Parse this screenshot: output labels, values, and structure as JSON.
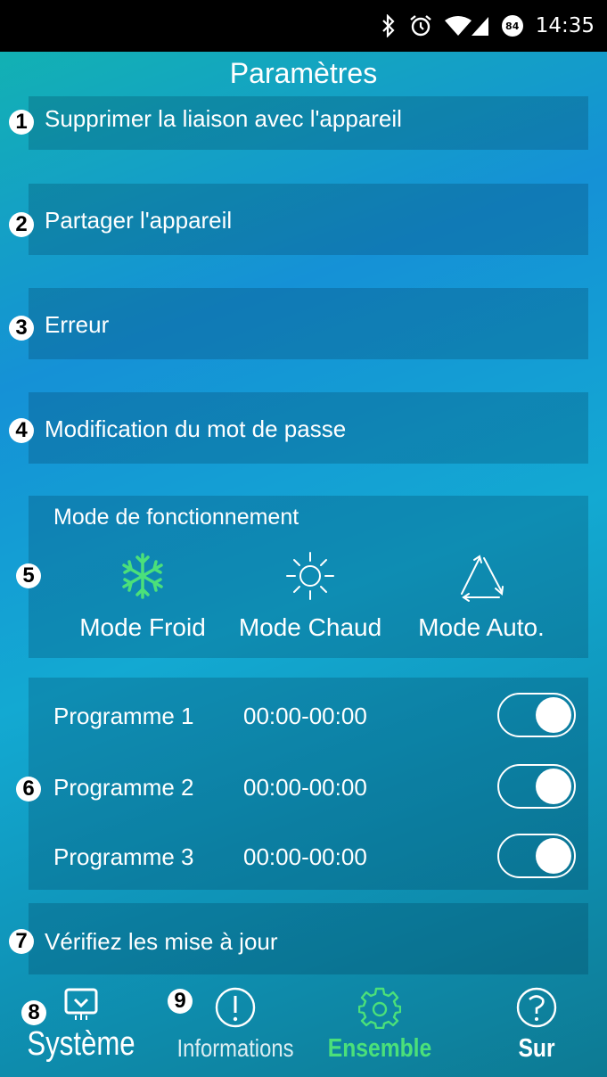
{
  "status_bar": {
    "time": "14:35",
    "battery_level": "84",
    "icons": [
      "bluetooth-icon",
      "alarm-icon",
      "wifi-icon",
      "signal-icon",
      "battery-icon"
    ]
  },
  "header": {
    "title": "Paramètres"
  },
  "markers": [
    "1",
    "2",
    "3",
    "4",
    "5",
    "6",
    "7",
    "8",
    "9"
  ],
  "menu": {
    "unlink": "Supprimer la liaison avec l'appareil",
    "share": "Partager l'appareil",
    "error": "Erreur",
    "password": "Modification du mot de passe",
    "update": "Vérifiez les mise à jour"
  },
  "operating_mode": {
    "title": "Mode de fonctionnement",
    "modes": [
      {
        "label": "Mode Froid",
        "icon": "snowflake-icon",
        "active": true
      },
      {
        "label": "Mode Chaud",
        "icon": "sun-icon",
        "active": false
      },
      {
        "label": "Mode Auto.",
        "icon": "triangle-cycle-icon",
        "active": false
      }
    ],
    "active_color": "#4be07a"
  },
  "programs": [
    {
      "name": "Programme 1",
      "time": "00:00-00:00",
      "enabled": true
    },
    {
      "name": "Programme 2",
      "time": "00:00-00:00",
      "enabled": true
    },
    {
      "name": "Programme 3",
      "time": "00:00-00:00",
      "enabled": true
    }
  ],
  "nav": {
    "items": [
      {
        "label": "Système",
        "icon": "monitor-icon"
      },
      {
        "label": "Informations",
        "icon": "info-circle-icon"
      },
      {
        "label": "Ensemble",
        "icon": "gear-icon",
        "active": true
      },
      {
        "label": "Sur",
        "icon": "question-circle-icon"
      }
    ],
    "active_color": "#4be07a"
  }
}
